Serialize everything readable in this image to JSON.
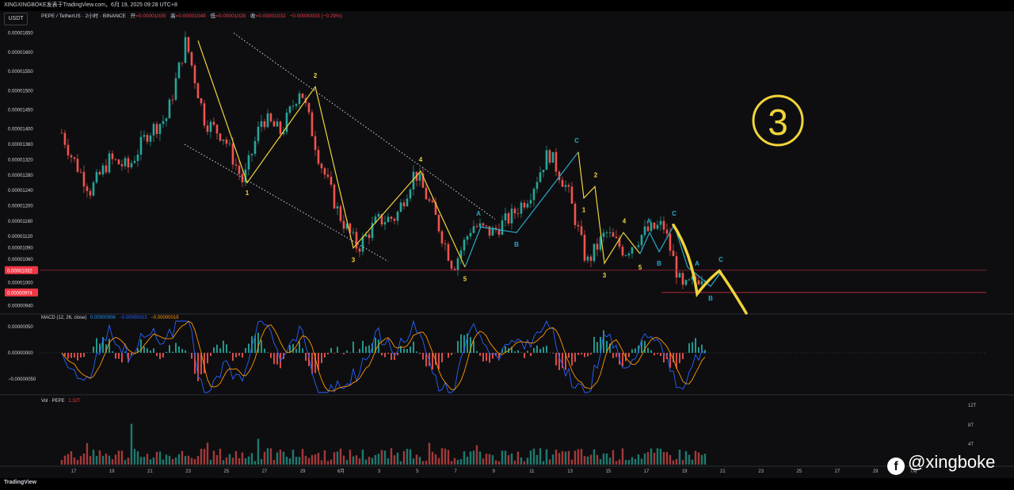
{
  "header": {
    "title": "XINGXINGBOKE发表于TradingView.com，6月 19, 2025 09:28 UTC+8",
    "currency": "USDT",
    "symbol": "PEPE / TetherUS · 2小时 · BINANCE",
    "open_label": "开",
    "open_value": "=0.00001035",
    "high_label": "高",
    "high_value": "=0.00001049",
    "low_label": "低",
    "low_value": "=0.00001028",
    "close_label": "收",
    "close_value": "=0.00001032",
    "change_value": "−0.00000003 (−0.29%)"
  },
  "price_axis": {
    "ticks": [
      "0.00001650",
      "0.00001600",
      "0.00001550",
      "0.00001500",
      "0.00001450",
      "0.00001400",
      "0.00001360",
      "0.00001320",
      "0.00001280",
      "0.00001240",
      "0.00001200",
      "0.00001160",
      "0.00001120",
      "0.00001090",
      "0.00001060",
      "0.00001030",
      "0.00001000",
      "0.00000970",
      "0.00000940"
    ],
    "current_price_badge": "0.00001032",
    "level_badge": "0.00000974",
    "colors": {
      "badge": "#f23645",
      "level_line": "#b2283a"
    }
  },
  "macd": {
    "label": "MACD (12, 26, close)",
    "hist_value": "0.00000006",
    "macd_value": "−0.00000013",
    "signal_value": "−0.00000019",
    "ticks": [
      "0.00000050",
      "0.00000000",
      "−0.00000050"
    ]
  },
  "volume": {
    "label": "Vol · PEPE",
    "value": "1.32T",
    "ticks": [
      "12T",
      "8T",
      "4T"
    ]
  },
  "time_axis": [
    "17",
    "19",
    "21",
    "23",
    "25",
    "27",
    "29",
    "6月",
    "3",
    "5",
    "7",
    "9",
    "11",
    "13",
    "15",
    "17",
    "19",
    "21",
    "23",
    "25",
    "27",
    "29",
    "7月"
  ],
  "annotations": {
    "circled_number": "3",
    "wave_labels": [
      "1",
      "2",
      "3",
      "4",
      "5",
      "A",
      "B",
      "C",
      "1",
      "2",
      "3",
      "4",
      "5",
      "A",
      "B",
      "C",
      "A",
      "B",
      "C"
    ],
    "colors": {
      "impulse": "#f0d43a",
      "correction": "#2aa8c9"
    }
  },
  "footer": {
    "logo": "TradingView"
  },
  "watermark": {
    "icon": "facebook-icon",
    "handle": "@xingboke"
  },
  "chart_data": {
    "type": "candlestick",
    "title": "PEPE / TetherUS · 2小时 · BINANCE",
    "ylim": [
      9.2e-06,
      1.67e-05
    ],
    "x_labels": [
      "17",
      "19",
      "21",
      "23",
      "25",
      "27",
      "29",
      "6月",
      "3",
      "5",
      "7",
      "9",
      "11",
      "13",
      "15",
      "17",
      "19",
      "21",
      "23",
      "25",
      "27",
      "29",
      "7月"
    ],
    "price_path": [
      {
        "x": "May 16 12:00",
        "price": 1.39e-05
      },
      {
        "x": "May 17",
        "price": 1.33e-05
      },
      {
        "x": "May 18",
        "price": 1.24e-05
      },
      {
        "x": "May 19",
        "price": 1.32e-05
      },
      {
        "x": "May 20",
        "price": 1.3e-05
      },
      {
        "x": "May 21",
        "price": 1.39e-05
      },
      {
        "x": "May 22",
        "price": 1.43e-05
      },
      {
        "x": "May 23",
        "price": 1.63e-05
      },
      {
        "x": "May 24",
        "price": 1.42e-05
      },
      {
        "x": "May 25",
        "price": 1.38e-05
      },
      {
        "x": "May 26",
        "price": 1.26e-05
      },
      {
        "x": "May 27",
        "price": 1.43e-05
      },
      {
        "x": "May 28",
        "price": 1.39e-05
      },
      {
        "x": "May 29",
        "price": 1.51e-05
      },
      {
        "x": "May 30",
        "price": 1.32e-05
      },
      {
        "x": "May 31",
        "price": 1.18e-05
      },
      {
        "x": "Jun 1",
        "price": 1.09e-05
      },
      {
        "x": "Jun 2",
        "price": 1.16e-05
      },
      {
        "x": "Jun 3",
        "price": 1.17e-05
      },
      {
        "x": "Jun 4",
        "price": 1.29e-05
      },
      {
        "x": "Jun 5",
        "price": 1.18e-05
      },
      {
        "x": "Jun 6",
        "price": 1.04e-05
      },
      {
        "x": "Jun 7",
        "price": 1.15e-05
      },
      {
        "x": "Jun 8",
        "price": 1.13e-05
      },
      {
        "x": "Jun 9",
        "price": 1.17e-05
      },
      {
        "x": "Jun 10",
        "price": 1.23e-05
      },
      {
        "x": "Jun 11",
        "price": 1.34e-05
      },
      {
        "x": "Jun 12",
        "price": 1.24e-05
      },
      {
        "x": "Jun 13",
        "price": 1.05e-05
      },
      {
        "x": "Jun 14",
        "price": 1.13e-05
      },
      {
        "x": "Jun 15",
        "price": 1.08e-05
      },
      {
        "x": "Jun 16",
        "price": 1.13e-05
      },
      {
        "x": "Jun 17",
        "price": 1.15e-05
      },
      {
        "x": "Jun 18",
        "price": 9.8e-06
      },
      {
        "x": "Jun 19 08:00",
        "price": 1.032e-05
      }
    ],
    "horizontal_levels": [
      1.032e-05,
      9.74e-06
    ],
    "volume_max": 12,
    "volume_units": "T"
  }
}
